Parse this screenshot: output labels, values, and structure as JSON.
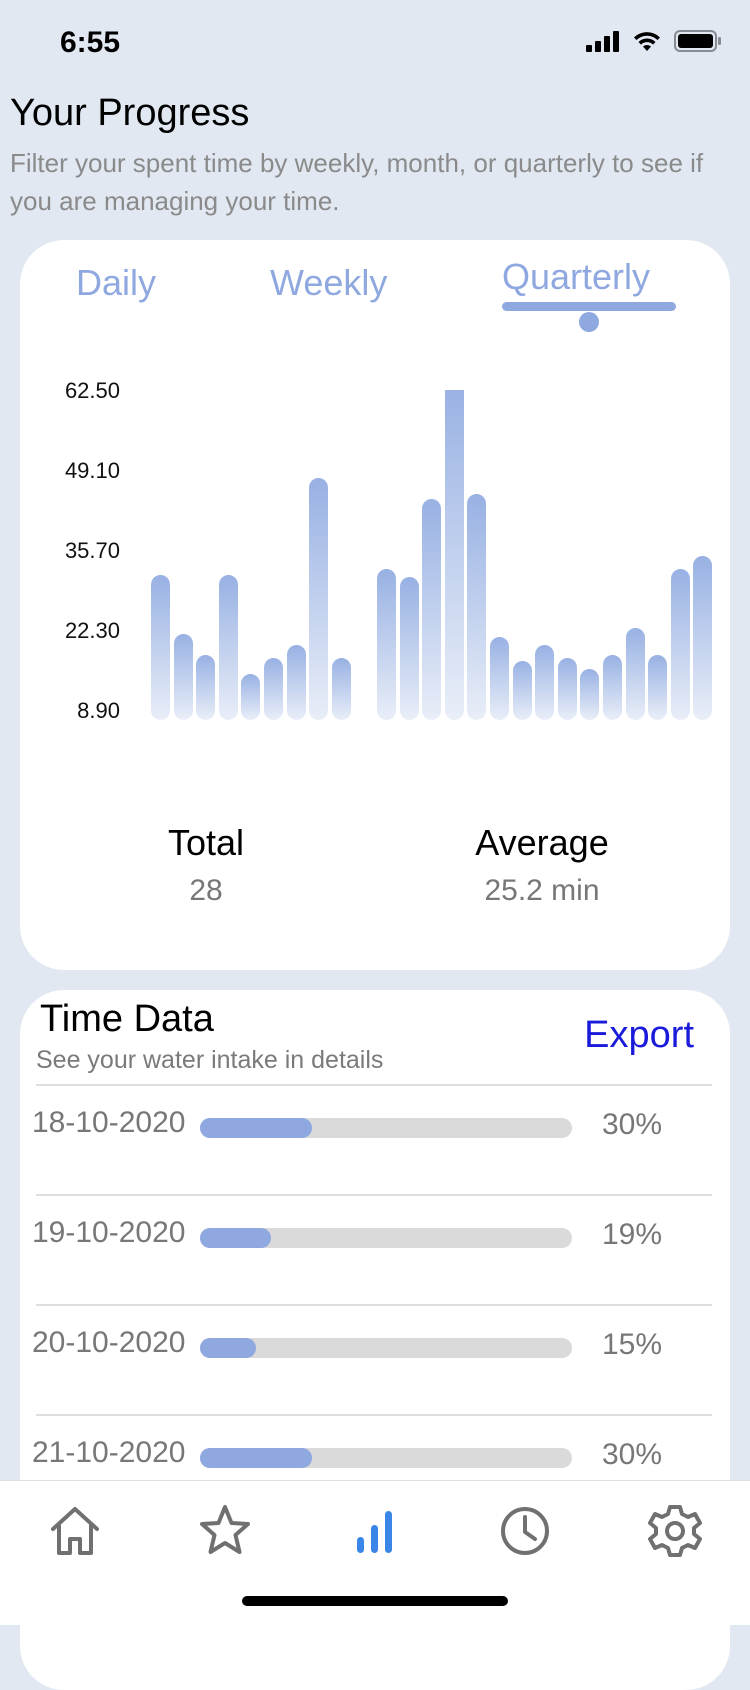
{
  "status": {
    "time": "6:55"
  },
  "header": {
    "title": "Your Progress",
    "subtitle": "Filter your spent time by weekly, month, or quarterly to see if you are managing your time."
  },
  "tabs": [
    {
      "label": "Daily",
      "active": false
    },
    {
      "label": "Weekly",
      "active": false
    },
    {
      "label": "Quarterly",
      "active": true
    }
  ],
  "chart_data": {
    "type": "bar",
    "y_ticks": [
      "62.50",
      "49.10",
      "35.70",
      "22.30",
      "8.90"
    ],
    "ylim": [
      8.9,
      62.5
    ],
    "values": [
      27,
      16,
      12,
      27,
      8.5,
      11.5,
      14,
      45,
      11.5,
      null,
      28,
      26.5,
      41,
      63,
      42,
      15.5,
      11,
      14,
      11.5,
      9.5,
      12,
      17,
      12,
      28,
      30.5
    ],
    "color": "#98b1e3"
  },
  "stats": {
    "total_label": "Total",
    "total_value": "28",
    "average_label": "Average",
    "average_value": "25.2 min"
  },
  "time_data": {
    "title": "Time Data",
    "subtitle": "See your water intake in details",
    "export_label": "Export",
    "rows": [
      {
        "date": "18-10-2020",
        "percent": "30%",
        "fraction": 0.3
      },
      {
        "date": "19-10-2020",
        "percent": "19%",
        "fraction": 0.19
      },
      {
        "date": "20-10-2020",
        "percent": "15%",
        "fraction": 0.15
      },
      {
        "date": "21-10-2020",
        "percent": "30%",
        "fraction": 0.3
      }
    ]
  },
  "nav": {
    "items": [
      {
        "icon": "home-icon",
        "active": false
      },
      {
        "icon": "star-icon",
        "active": false
      },
      {
        "icon": "bar-chart-icon",
        "active": true
      },
      {
        "icon": "clock-icon",
        "active": false
      },
      {
        "icon": "gear-icon",
        "active": false
      }
    ]
  },
  "colors": {
    "accent": "#8fa8e0",
    "active_nav": "#3a86e8",
    "inactive_nav": "#707070",
    "export": "#1a1adb"
  }
}
